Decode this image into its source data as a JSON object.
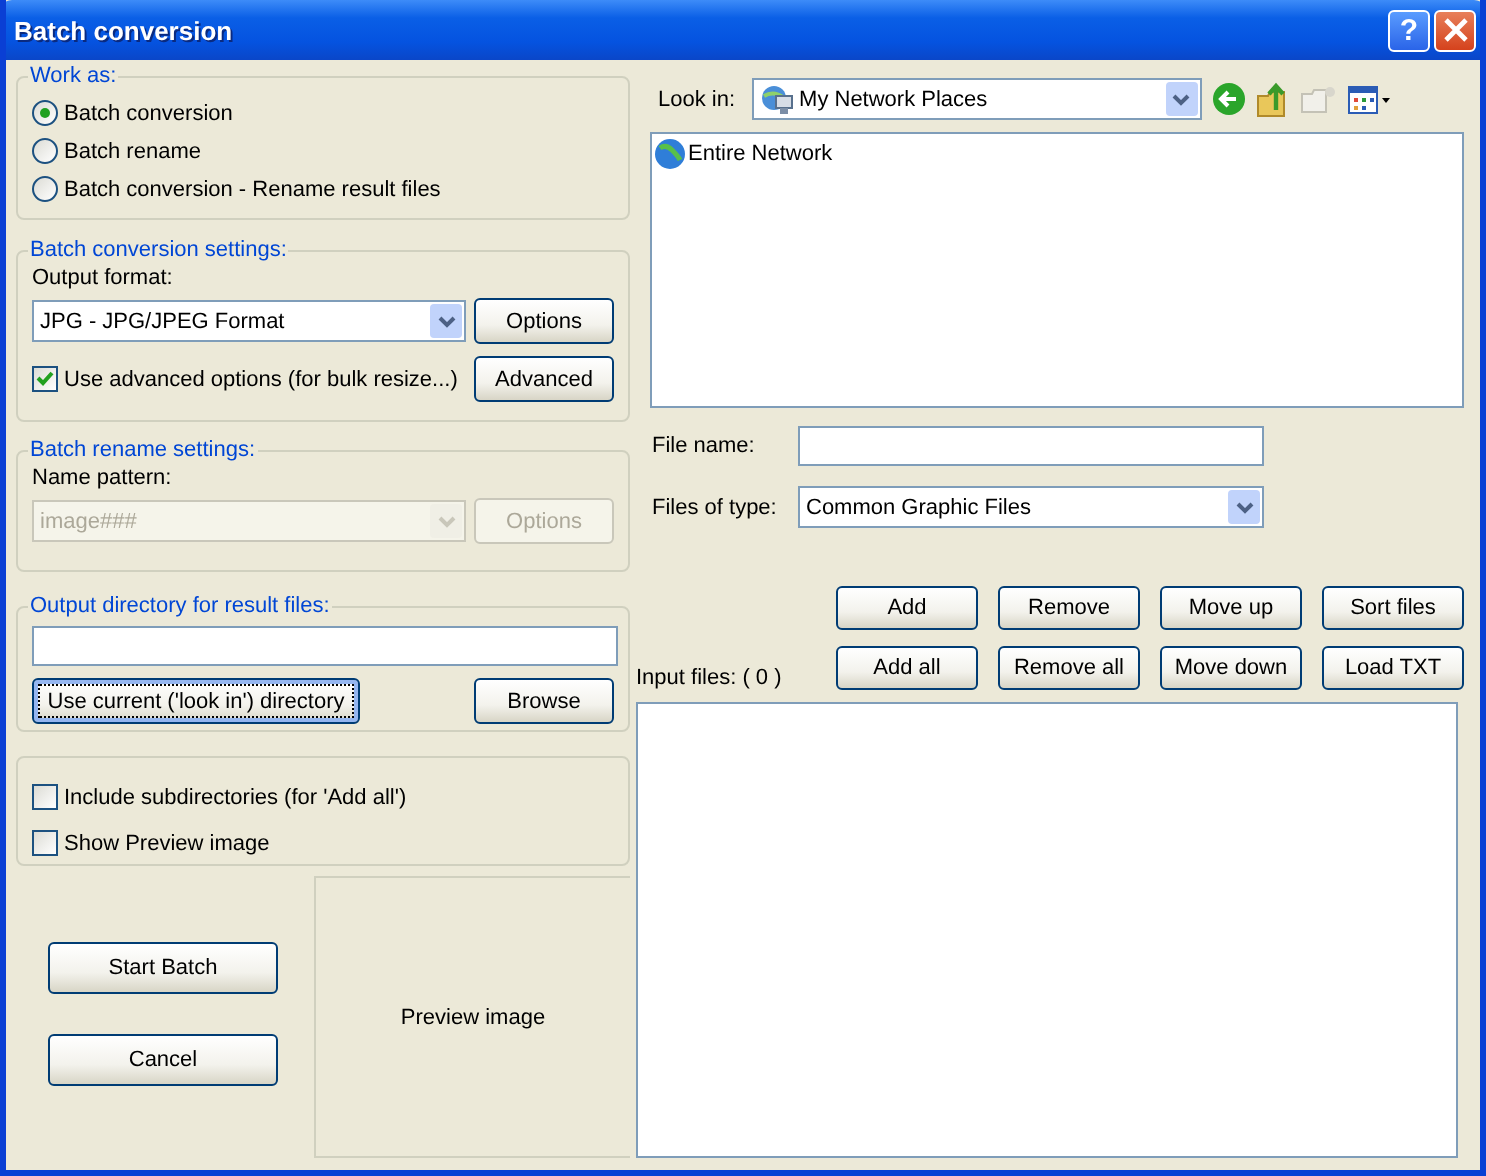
{
  "window": {
    "title": "Batch conversion",
    "help_label": "?"
  },
  "work_as": {
    "title": "Work as:",
    "options": [
      {
        "label": "Batch conversion",
        "selected": true
      },
      {
        "label": "Batch rename",
        "selected": false
      },
      {
        "label": "Batch conversion - Rename result files",
        "selected": false
      }
    ]
  },
  "conversion_settings": {
    "title": "Batch conversion settings:",
    "output_format_label": "Output format:",
    "output_format": {
      "value": "JPG - JPG/JPEG Format",
      "disabled": false
    },
    "options_button": {
      "label": "Options",
      "disabled": false
    },
    "advanced_checkbox": {
      "label": "Use advanced options (for bulk resize...)",
      "checked": true
    },
    "advanced_button": {
      "label": "Advanced",
      "disabled": false
    }
  },
  "rename_settings": {
    "title": "Batch rename settings:",
    "name_pattern_label": "Name pattern:",
    "name_pattern": {
      "value": "image###",
      "disabled": true
    },
    "options_button": {
      "label": "Options",
      "disabled": true
    }
  },
  "output_directory": {
    "title": "Output directory for result files:",
    "use_current_button": {
      "label": "Use current ('look in') directory",
      "focused": true
    },
    "browse_button": {
      "label": "Browse",
      "focused": false
    }
  },
  "include_options": [
    {
      "label": "Include subdirectories (for 'Add all')",
      "checked": false
    },
    {
      "label": "Show Preview image",
      "checked": false
    }
  ],
  "start_button": {
    "label": "Start Batch"
  },
  "cancel_button": {
    "label": "Cancel"
  },
  "preview": {
    "label": "Preview image"
  },
  "browser": {
    "look_in_label": "Look in:",
    "look_in": "My Network Places",
    "items": [
      {
        "label": "Entire Network",
        "selected": false
      }
    ],
    "file_name_label": "File name:",
    "files_of_type_label": "Files of type:",
    "files_of_type": "Common Graphic Files"
  },
  "file_buttons": [
    [
      "Add",
      "Remove",
      "Move up",
      "Sort files"
    ],
    [
      "Add all",
      "Remove all",
      "Move down",
      "Load TXT"
    ]
  ],
  "input_files": {
    "label": "Input files: ( 0 )"
  }
}
